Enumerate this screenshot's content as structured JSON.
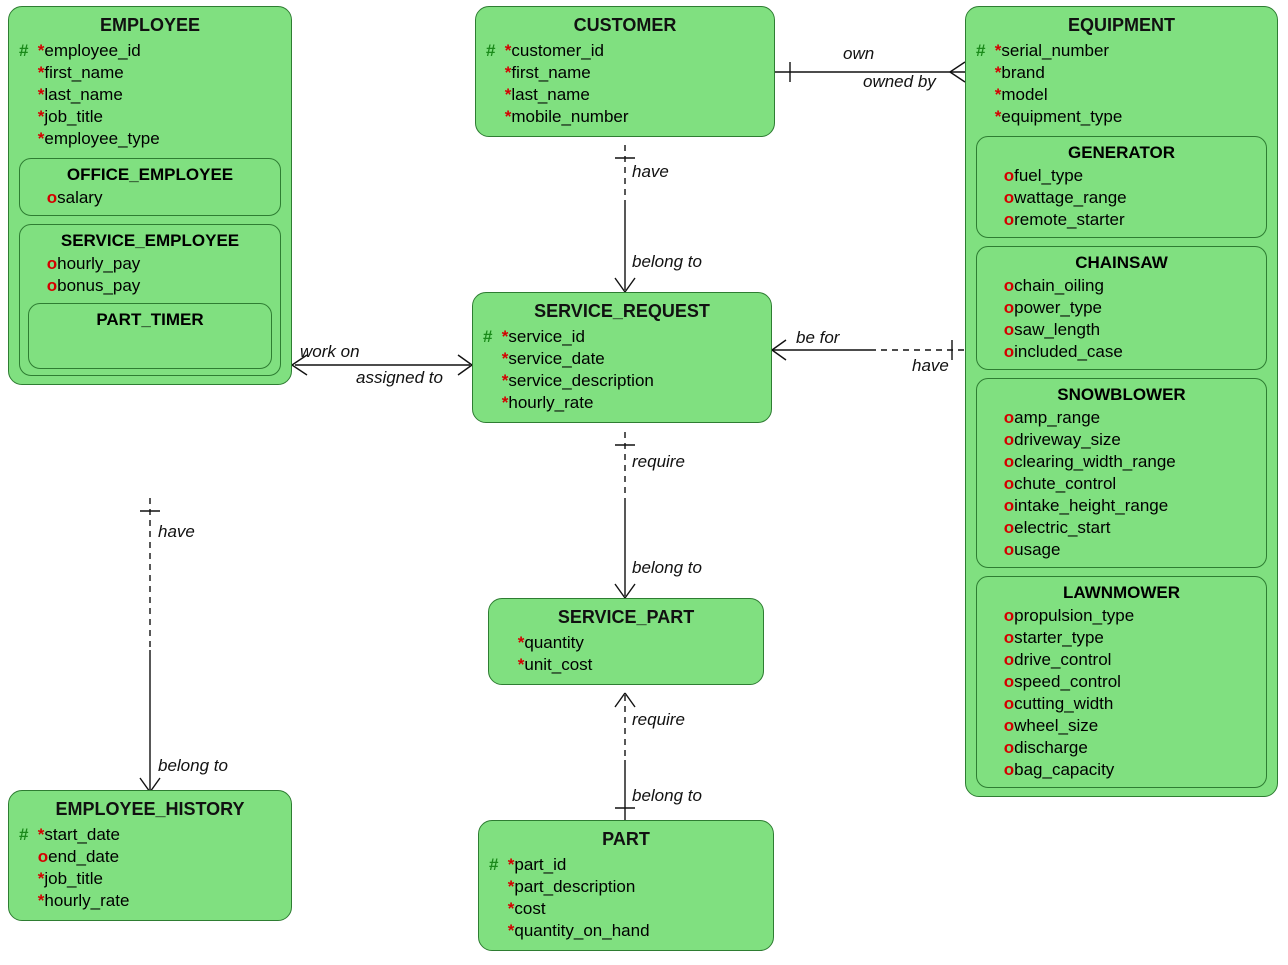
{
  "entities": {
    "employee": {
      "title": "EMPLOYEE",
      "attrs": [
        {
          "pk": true,
          "req": true,
          "name": "employee_id"
        },
        {
          "pk": false,
          "req": true,
          "name": "first_name"
        },
        {
          "pk": false,
          "req": true,
          "name": "last_name"
        },
        {
          "pk": false,
          "req": true,
          "name": "job_title"
        },
        {
          "pk": false,
          "req": true,
          "name": "employee_type"
        }
      ],
      "subtypes": [
        {
          "title": "OFFICE_EMPLOYEE",
          "attrs": [
            {
              "req": false,
              "name": "salary"
            }
          ]
        },
        {
          "title": "SERVICE_EMPLOYEE",
          "attrs": [
            {
              "req": false,
              "name": "hourly_pay"
            },
            {
              "req": false,
              "name": "bonus_pay"
            }
          ],
          "subtypes": [
            {
              "title": "PART_TIMER",
              "attrs": []
            }
          ]
        }
      ]
    },
    "customer": {
      "title": "CUSTOMER",
      "attrs": [
        {
          "pk": true,
          "req": true,
          "name": "customer_id"
        },
        {
          "pk": false,
          "req": true,
          "name": "first_name"
        },
        {
          "pk": false,
          "req": true,
          "name": "last_name"
        },
        {
          "pk": false,
          "req": true,
          "name": "mobile_number"
        }
      ]
    },
    "equipment": {
      "title": "EQUIPMENT",
      "attrs": [
        {
          "pk": true,
          "req": true,
          "name": "serial_number"
        },
        {
          "pk": false,
          "req": true,
          "name": "brand"
        },
        {
          "pk": false,
          "req": true,
          "name": "model"
        },
        {
          "pk": false,
          "req": true,
          "name": "equipment_type"
        }
      ],
      "subtypes": [
        {
          "title": "GENERATOR",
          "attrs": [
            {
              "req": false,
              "name": "fuel_type"
            },
            {
              "req": false,
              "name": "wattage_range"
            },
            {
              "req": false,
              "name": "remote_starter"
            }
          ]
        },
        {
          "title": "CHAINSAW",
          "attrs": [
            {
              "req": false,
              "name": "chain_oiling"
            },
            {
              "req": false,
              "name": "power_type"
            },
            {
              "req": false,
              "name": "saw_length"
            },
            {
              "req": false,
              "name": "included_case"
            }
          ]
        },
        {
          "title": "SNOWBLOWER",
          "attrs": [
            {
              "req": false,
              "name": "amp_range"
            },
            {
              "req": false,
              "name": "driveway_size"
            },
            {
              "req": false,
              "name": "clearing_width_range"
            },
            {
              "req": false,
              "name": "chute_control"
            },
            {
              "req": false,
              "name": "intake_height_range"
            },
            {
              "req": false,
              "name": "electric_start"
            },
            {
              "req": false,
              "name": "usage"
            }
          ]
        },
        {
          "title": "LAWNMOWER",
          "attrs": [
            {
              "req": false,
              "name": "propulsion_type"
            },
            {
              "req": false,
              "name": "starter_type"
            },
            {
              "req": false,
              "name": "drive_control"
            },
            {
              "req": false,
              "name": "speed_control"
            },
            {
              "req": false,
              "name": "cutting_width"
            },
            {
              "req": false,
              "name": "wheel_size"
            },
            {
              "req": false,
              "name": "discharge"
            },
            {
              "req": false,
              "name": "bag_capacity"
            }
          ]
        }
      ]
    },
    "service_request": {
      "title": "SERVICE_REQUEST",
      "attrs": [
        {
          "pk": true,
          "req": true,
          "name": "service_id"
        },
        {
          "pk": false,
          "req": true,
          "name": "service_date"
        },
        {
          "pk": false,
          "req": true,
          "name": "service_description"
        },
        {
          "pk": false,
          "req": true,
          "name": "hourly_rate"
        }
      ]
    },
    "service_part": {
      "title": "SERVICE_PART",
      "attrs": [
        {
          "pk": false,
          "req": true,
          "name": "quantity"
        },
        {
          "pk": false,
          "req": true,
          "name": "unit_cost"
        }
      ]
    },
    "part": {
      "title": "PART",
      "attrs": [
        {
          "pk": true,
          "req": true,
          "name": "part_id"
        },
        {
          "pk": false,
          "req": true,
          "name": "part_description"
        },
        {
          "pk": false,
          "req": true,
          "name": "cost"
        },
        {
          "pk": false,
          "req": true,
          "name": "quantity_on_hand"
        }
      ]
    },
    "employee_history": {
      "title": "EMPLOYEE_HISTORY",
      "attrs": [
        {
          "pk": true,
          "req": true,
          "name": "start_date"
        },
        {
          "pk": false,
          "req": false,
          "name": "end_date"
        },
        {
          "pk": false,
          "req": true,
          "name": "job_title"
        },
        {
          "pk": false,
          "req": true,
          "name": "hourly_rate"
        }
      ]
    }
  },
  "relationships": {
    "cust_equip_own": "own",
    "cust_equip_ownedby": "owned by",
    "cust_sr_have": "have",
    "cust_sr_belong": "belong to",
    "emp_sr_work": "work on",
    "emp_sr_assigned": "assigned to",
    "sr_equip_befor": "be for",
    "sr_equip_have": "have",
    "sr_sp_require": "require",
    "sr_sp_belong": "belong to",
    "sp_part_require": "require",
    "sp_part_belong": "belong to",
    "emp_hist_have": "have",
    "emp_hist_belong": "belong to"
  }
}
